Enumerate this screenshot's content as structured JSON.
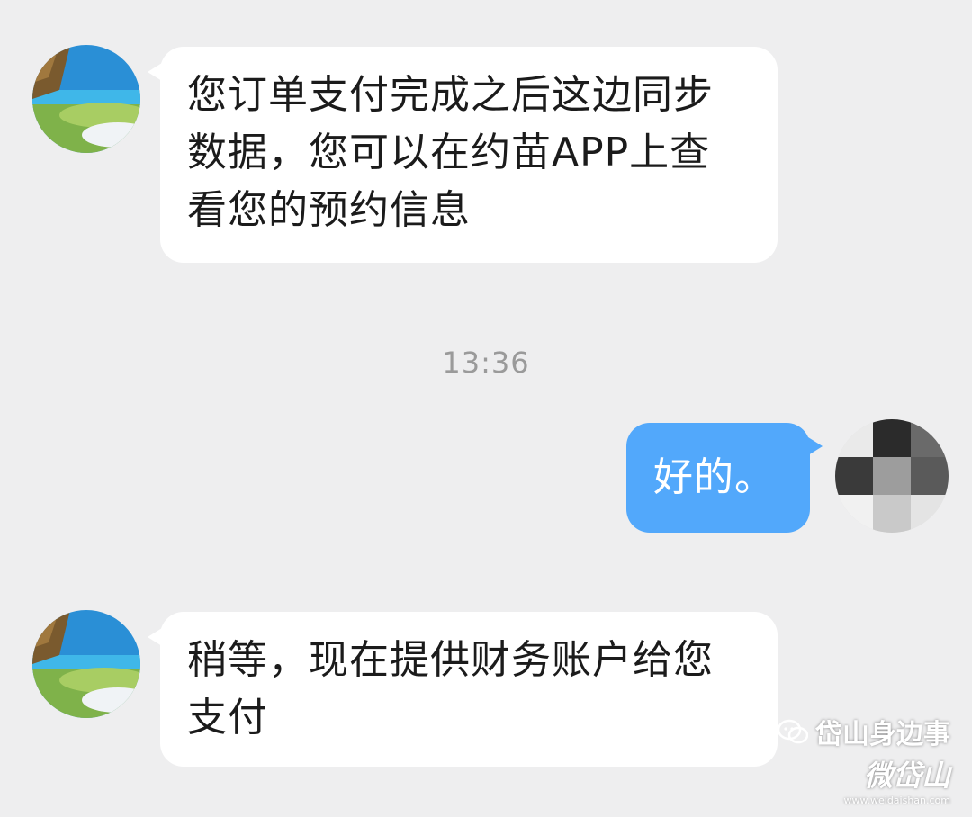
{
  "timestamp": "13:36",
  "messages": [
    {
      "direction": "incoming",
      "text": "您订单支付完成之后这边同步数据，您可以在约苗APP上查看您的预约信息"
    },
    {
      "direction": "outgoing",
      "text": "好的。"
    },
    {
      "direction": "incoming",
      "text": "稍等，现在提供财务账户给您支付"
    }
  ],
  "watermark": {
    "name": "岱山身边事",
    "brand": "微岱山",
    "url": "www.weidaishan.com"
  },
  "colors": {
    "background": "#eeeeef",
    "incoming_bubble": "#ffffff",
    "outgoing_bubble": "#52a8fb",
    "timestamp_text": "#9a9a9a"
  }
}
